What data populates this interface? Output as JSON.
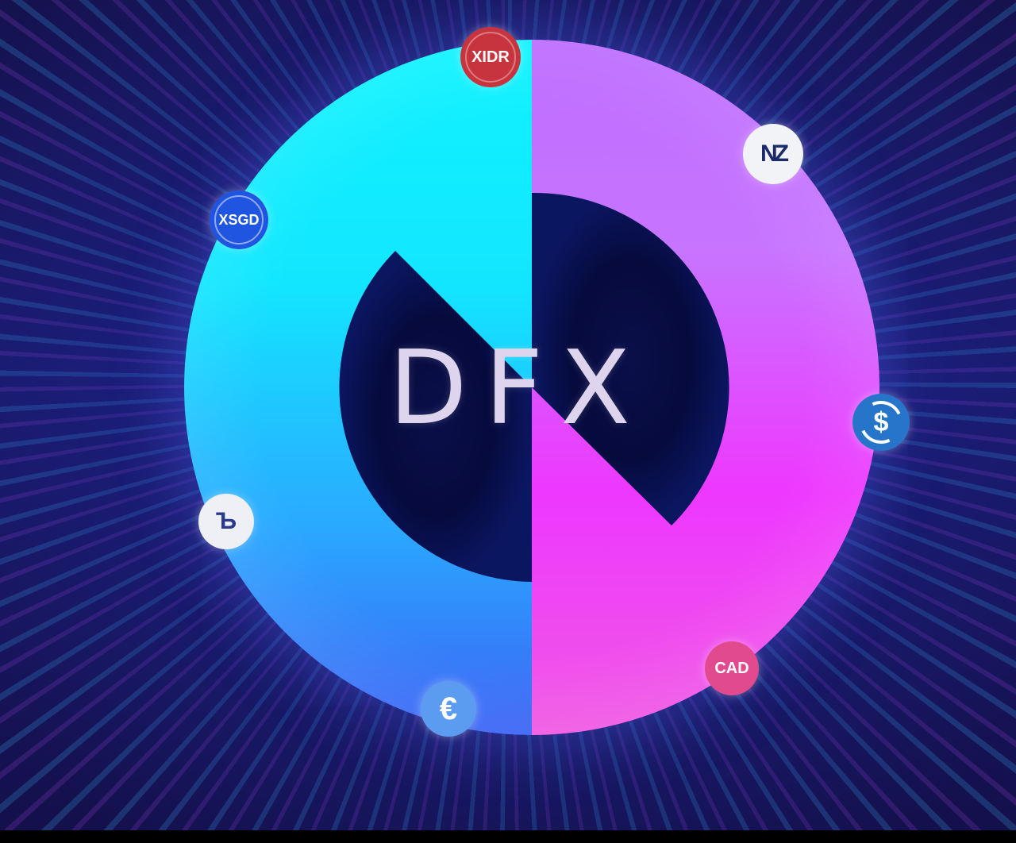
{
  "brand": {
    "wordmark": "DFX",
    "colors": {
      "cyan": "#0ff3ff",
      "blue": "#3b62f5",
      "violet": "#bd6cff",
      "magenta": "#ee37ff",
      "center": "#05083a"
    }
  },
  "tokens": [
    {
      "id": "idr",
      "label": "XIDR",
      "icon": "xidr-coin-icon",
      "color": "#c8343d"
    },
    {
      "id": "nzd",
      "label": "NZ",
      "icon": "nzds-coin-icon",
      "color": "#f2f3f7"
    },
    {
      "id": "usdc",
      "label": "$",
      "icon": "usdc-coin-icon",
      "color": "#2775ca"
    },
    {
      "id": "cad",
      "label": "CAD",
      "icon": "cadc-coin-icon",
      "color": "#e14a8e"
    },
    {
      "id": "eurs",
      "label": "€",
      "icon": "eurs-coin-icon",
      "color": "#5c9cf0"
    },
    {
      "id": "tryb",
      "label": "Ъ",
      "icon": "tryb-coin-icon",
      "color": "#eef0f6"
    },
    {
      "id": "sgd",
      "label": "XSGD",
      "icon": "xsgd-coin-icon",
      "color": "#1f55e0"
    }
  ]
}
